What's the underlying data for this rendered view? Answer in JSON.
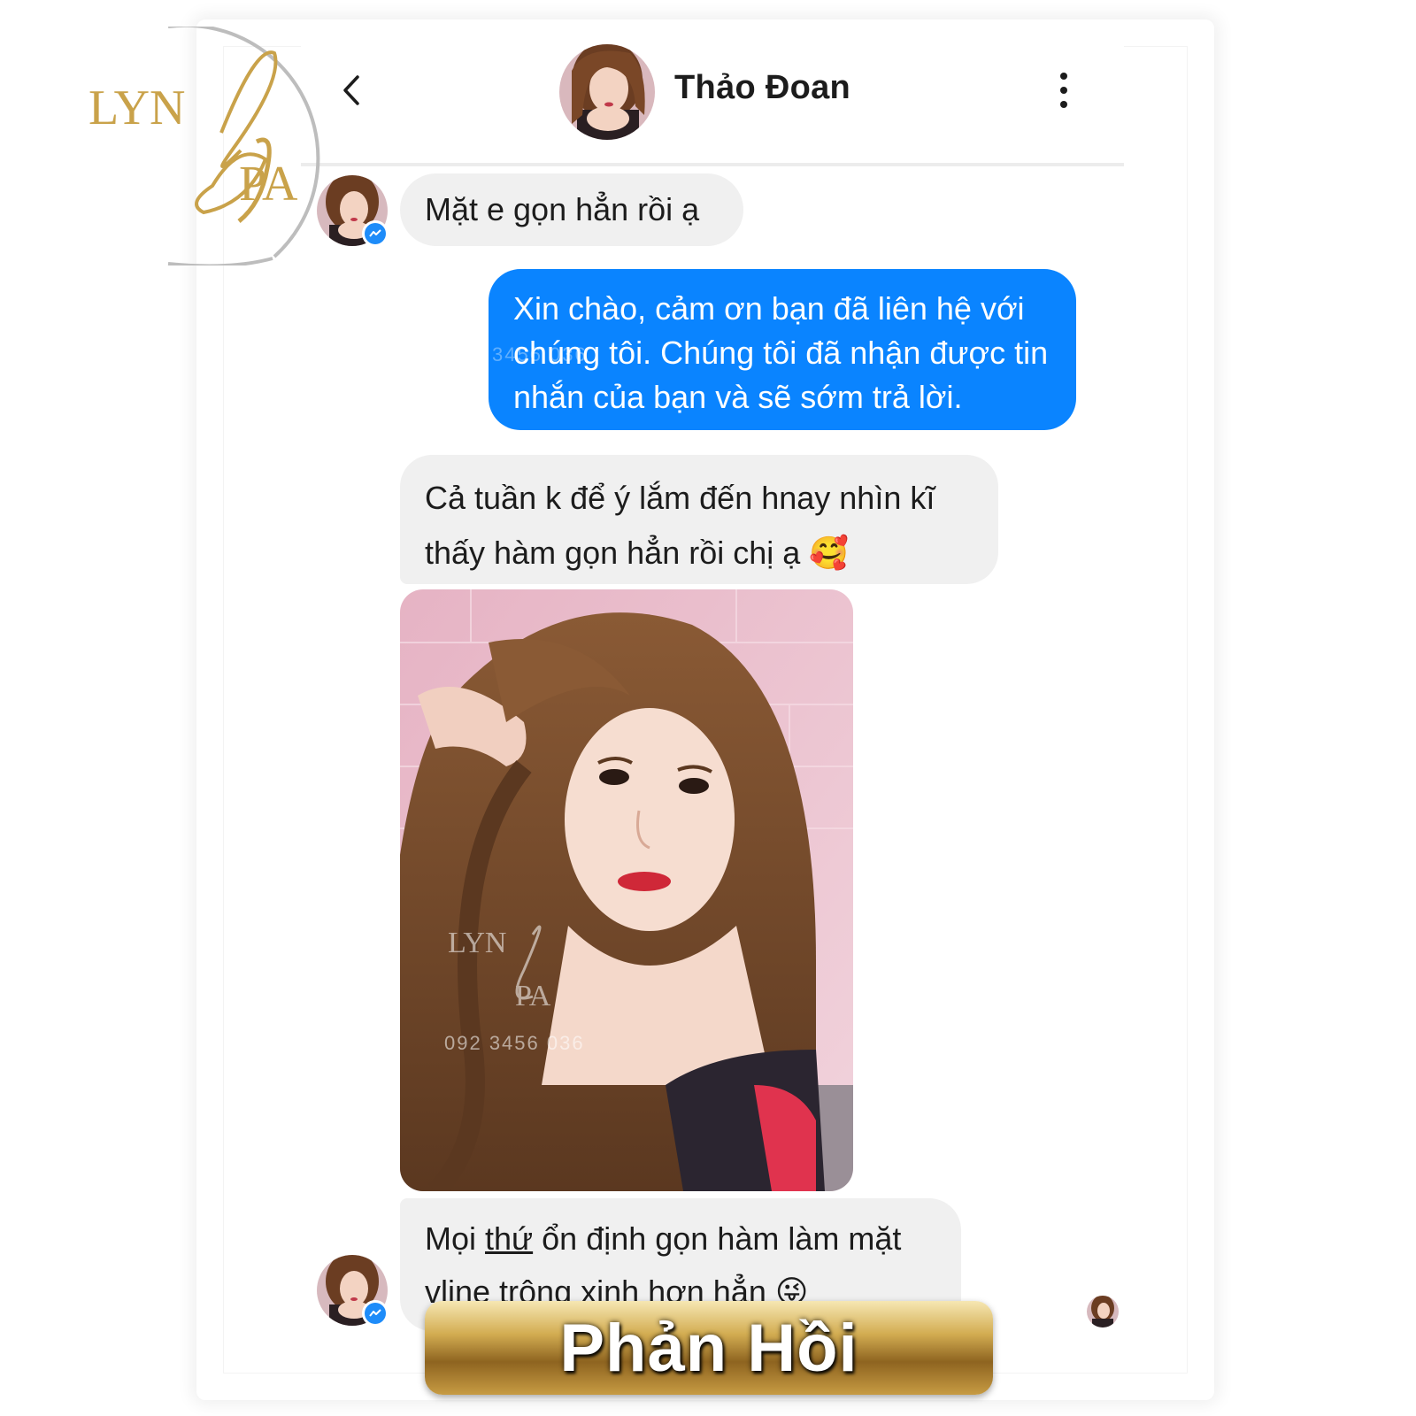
{
  "brand": {
    "logo_text_top": "LYN",
    "logo_text_bottom": "PA",
    "accent_gold": "#c9a24a"
  },
  "header": {
    "contact_name": "Thảo Đoan",
    "back_icon": "chevron-left-icon",
    "more_icon": "kebab-menu-icon"
  },
  "messages": [
    {
      "from": "contact",
      "text": "Mặt e gọn hẳn rồi ạ"
    },
    {
      "from": "self",
      "text": "Xin chào, cảm ơn bạn đã liên hệ với chúng tôi. Chúng tôi đã nhận được tin nhắn của bạn và sẽ sớm trả lời."
    },
    {
      "from": "contact",
      "text_line1": "Cả tuần k để ý lắm  đến hnay nhìn kĩ",
      "text_line2": "thấy hàm gọn hẳn rồi chị ạ",
      "emoji": "🥰"
    },
    {
      "from": "contact",
      "type": "photo",
      "watermark_top": "LYN",
      "watermark_bottom": "PA",
      "watermark_phone": "092 3456 036"
    },
    {
      "from": "contact",
      "text_pre": "Mọi ",
      "text_underlined": "thứ",
      "text_post": " ổn định gọn hàm làm mặt",
      "text_line2": "vline trông xinh hơn hẳn",
      "emoji": "😜"
    }
  ],
  "overlay_watermark_phone": "3456 036",
  "banner": {
    "label": "Phản Hồi"
  },
  "colors": {
    "sent_bubble": "#0a84ff",
    "received_bubble": "#f0f0f0",
    "messenger_blue": "#1e8cf9"
  }
}
